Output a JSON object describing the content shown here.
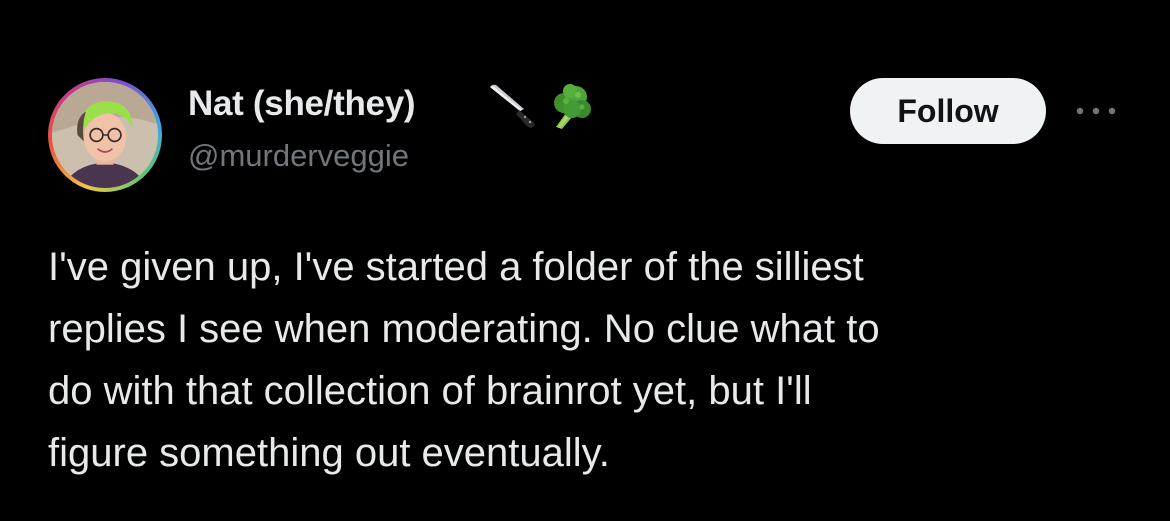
{
  "theme": {
    "background": "#000000",
    "text_primary": "#e7e9ea",
    "text_secondary": "#71767b",
    "follow_bg": "#eff3f4",
    "follow_text": "#0f1419"
  },
  "author": {
    "display_name": "Nat (she/they)",
    "handle": "@murderveggie",
    "avatar_icon": "avatar-photo",
    "badges": [
      "knife-emoji",
      "broccoli-emoji"
    ]
  },
  "actions": {
    "follow_label": "Follow",
    "more_icon": "more-dots-icon"
  },
  "tweet": {
    "lines": [
      "I've given up, I've started a folder of the silliest",
      "replies I see when moderating. No clue what to",
      "do with that collection of brainrot yet, but I'll",
      "figure something out eventually."
    ]
  }
}
